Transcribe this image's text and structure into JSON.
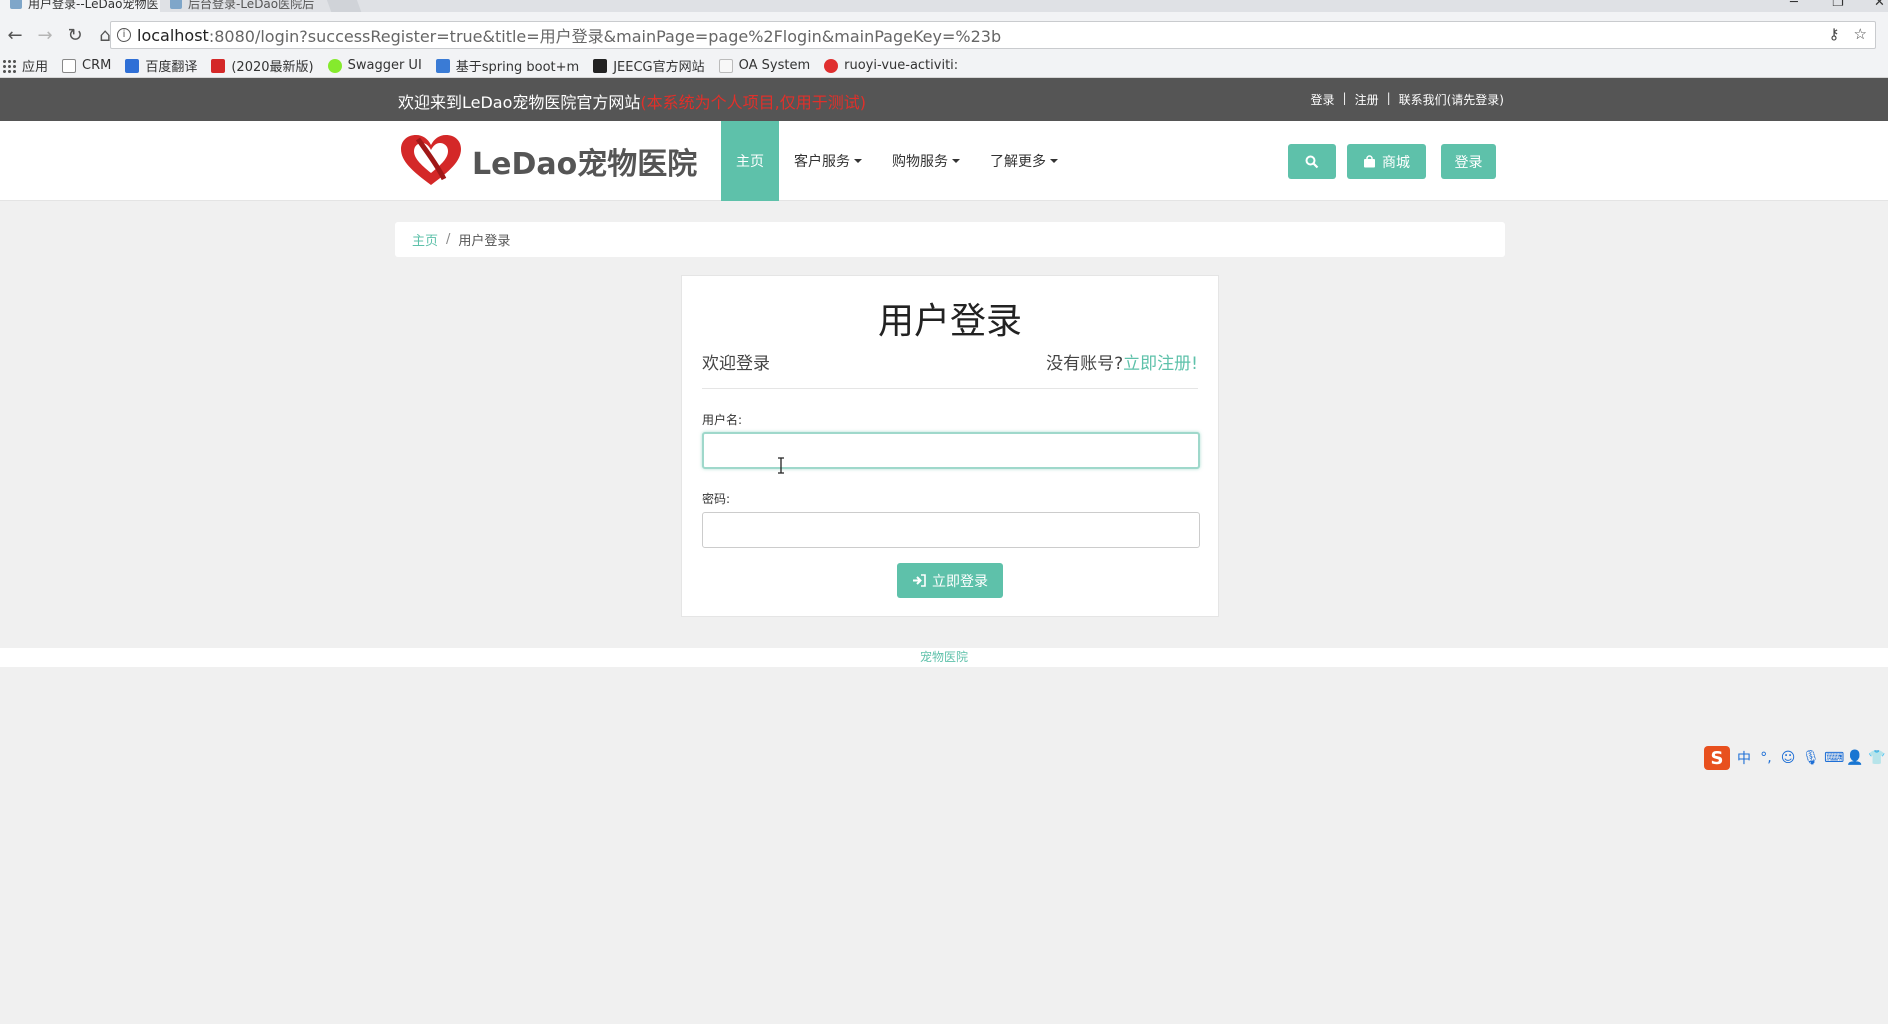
{
  "browser": {
    "tabs": [
      {
        "title": "用户登录--LeDao宠物医",
        "active": true
      },
      {
        "title": "后台登录-LeDao医院后",
        "active": false
      }
    ],
    "url_host": "localhost",
    "url_path": ":8080/login?successRegister=true&title=用户登录&mainPage=page%2Flogin&mainPageKey=%23b",
    "bookmarks": [
      {
        "label": "应用",
        "icon": "apps-icon"
      },
      {
        "label": "CRM",
        "icon": "page-icon"
      },
      {
        "label": "百度翻译",
        "icon": "translate-icon"
      },
      {
        "label": "(2020最新版)",
        "icon": "c-icon"
      },
      {
        "label": "Swagger UI",
        "icon": "swagger-icon"
      },
      {
        "label": "基于spring boot+m",
        "icon": "bookmark-icon"
      },
      {
        "label": "JEECG官方网站",
        "icon": "j-icon"
      },
      {
        "label": "OA System",
        "icon": "page-icon"
      },
      {
        "label": "ruoyi-vue-activiti: ",
        "icon": "g-icon"
      }
    ]
  },
  "topbar": {
    "welcome": "欢迎来到LeDao宠物医院官方网站",
    "note": "(本系统为个人项目,仅用于测试)",
    "login": "登录",
    "register": "注册",
    "contact": "联系我们(请先登录)",
    "sep": "|"
  },
  "header": {
    "logo_text": "LeDao宠物医院",
    "nav": [
      {
        "label": "主页",
        "active": true,
        "dropdown": false
      },
      {
        "label": "客户服务",
        "active": false,
        "dropdown": true
      },
      {
        "label": "购物服务",
        "active": false,
        "dropdown": true
      },
      {
        "label": "了解更多",
        "active": false,
        "dropdown": true
      }
    ],
    "shop_label": "商城",
    "login_label": "登录"
  },
  "breadcrumb": {
    "home": "主页",
    "sep": "/",
    "current": "用户登录"
  },
  "login": {
    "title": "用户登录",
    "subtitle": "欢迎登录",
    "no_account": "没有账号?",
    "register_link": "立即注册!",
    "username_label": "用户名:",
    "username_value": "",
    "password_label": "密码:",
    "password_value": "",
    "submit_label": "立即登录"
  },
  "footer": {
    "text": "宠物医院"
  },
  "ime": {
    "logo": "S",
    "mode": "中"
  },
  "colors": {
    "accent": "#5ec1aa",
    "topbar": "#555555",
    "note_red": "#e0302a",
    "logo_red": "#d42828"
  }
}
